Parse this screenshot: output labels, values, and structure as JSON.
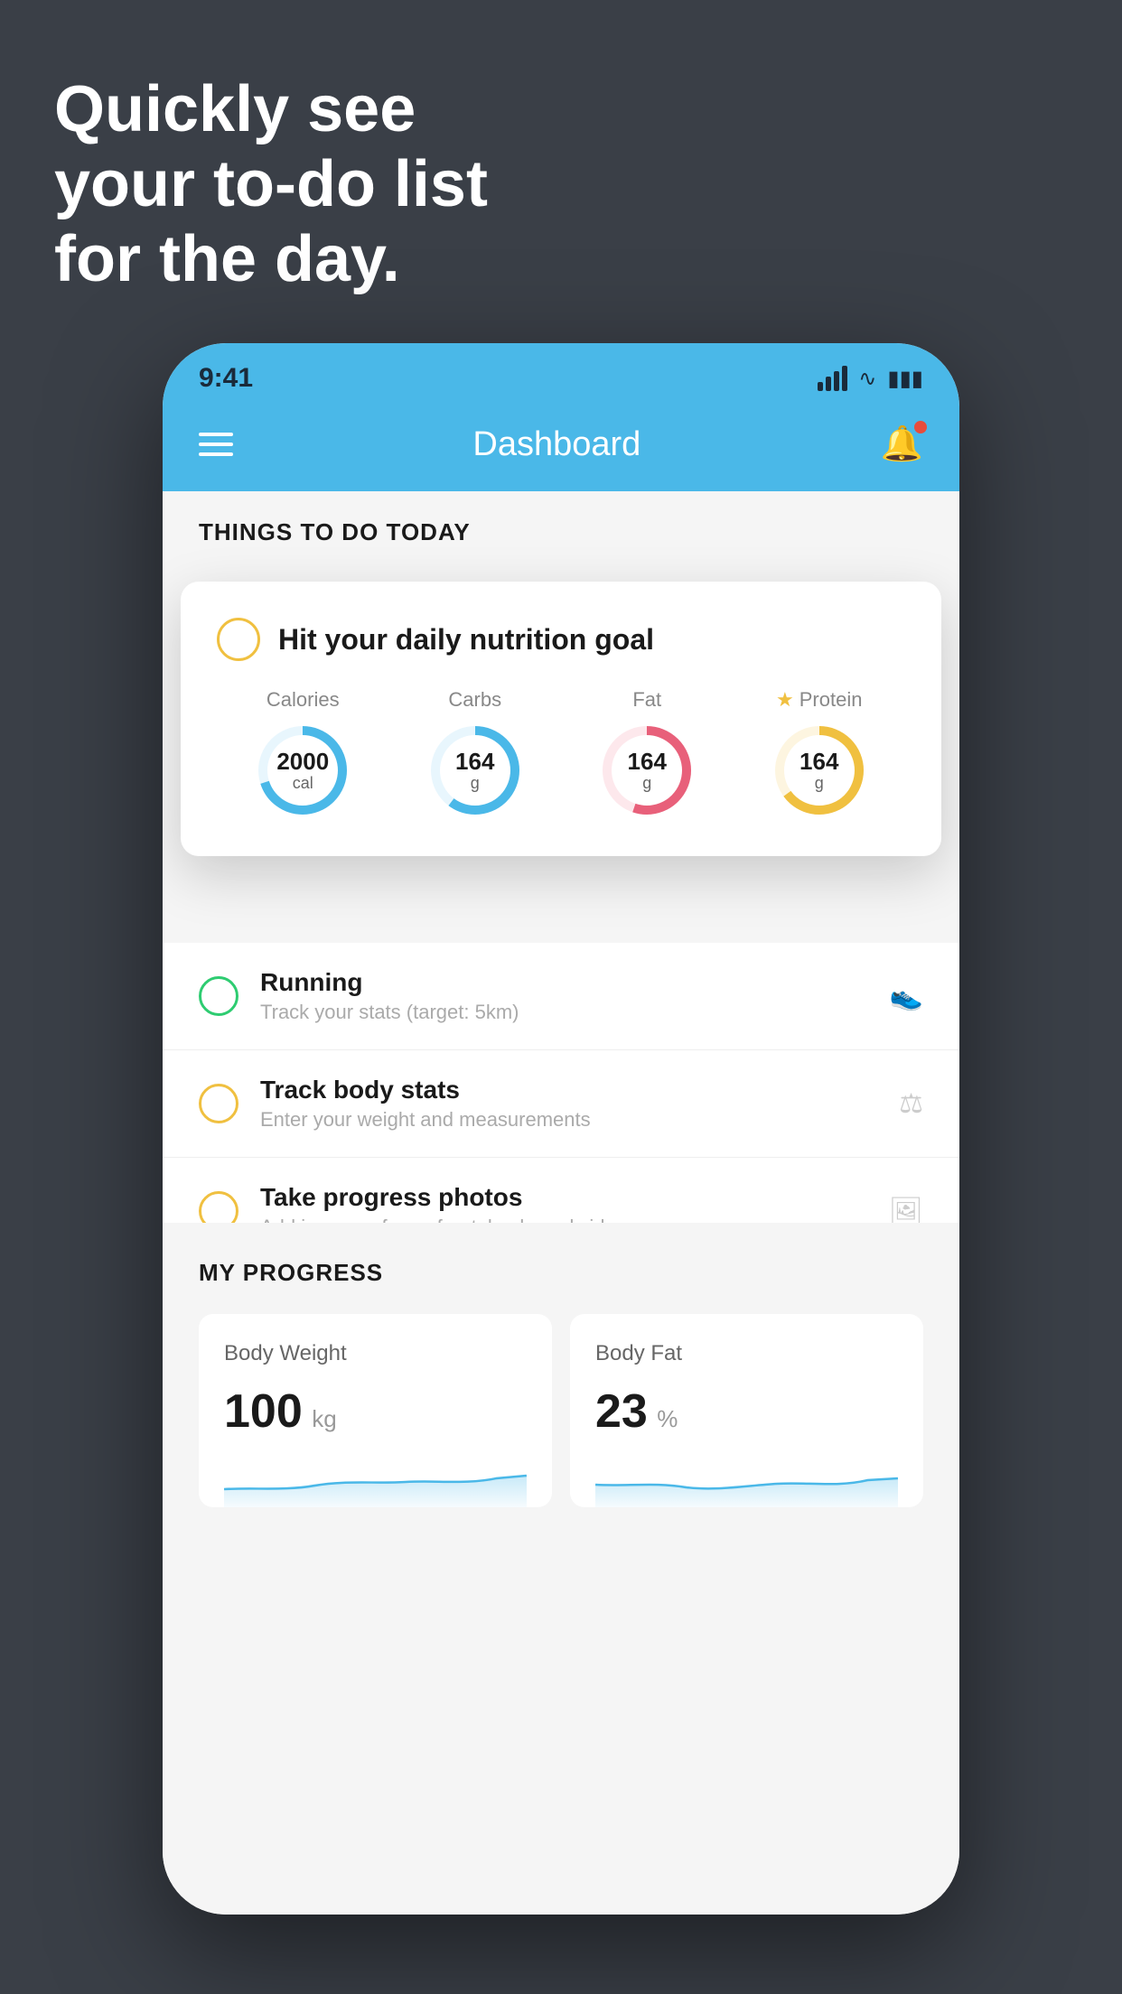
{
  "hero": {
    "line1": "Quickly see",
    "line2": "your to-do list",
    "line3": "for the day."
  },
  "status_bar": {
    "time": "9:41",
    "signal_alt": "signal bars",
    "wifi_alt": "wifi",
    "battery_alt": "battery"
  },
  "header": {
    "title": "Dashboard",
    "menu_label": "menu",
    "bell_label": "notifications"
  },
  "section_today": {
    "title": "THINGS TO DO TODAY"
  },
  "featured_card": {
    "title": "Hit your daily nutrition goal",
    "nutrition": [
      {
        "label": "Calories",
        "value": "2000",
        "unit": "cal",
        "color": "#4ab8e8",
        "starred": false,
        "pct": 70
      },
      {
        "label": "Carbs",
        "value": "164",
        "unit": "g",
        "color": "#4ab8e8",
        "starred": false,
        "pct": 60
      },
      {
        "label": "Fat",
        "value": "164",
        "unit": "g",
        "color": "#e8607a",
        "starred": false,
        "pct": 55
      },
      {
        "label": "Protein",
        "value": "164",
        "unit": "g",
        "color": "#f0c040",
        "starred": true,
        "pct": 65
      }
    ]
  },
  "todo_items": [
    {
      "title": "Running",
      "subtitle": "Track your stats (target: 5km)",
      "circle_color": "green",
      "icon": "👟"
    },
    {
      "title": "Track body stats",
      "subtitle": "Enter your weight and measurements",
      "circle_color": "yellow",
      "icon": "⚖"
    },
    {
      "title": "Take progress photos",
      "subtitle": "Add images of your front, back, and side",
      "circle_color": "yellow",
      "icon": "🖼"
    }
  ],
  "progress": {
    "section_title": "MY PROGRESS",
    "cards": [
      {
        "label": "Body Weight",
        "value": "100",
        "unit": "kg"
      },
      {
        "label": "Body Fat",
        "value": "23",
        "unit": "%"
      }
    ]
  },
  "colors": {
    "bg": "#3a3f47",
    "header_blue": "#4ab8e8",
    "accent_yellow": "#f0c040",
    "accent_green": "#2ecc71",
    "accent_red": "#e74c3c",
    "accent_pink": "#e8607a"
  }
}
